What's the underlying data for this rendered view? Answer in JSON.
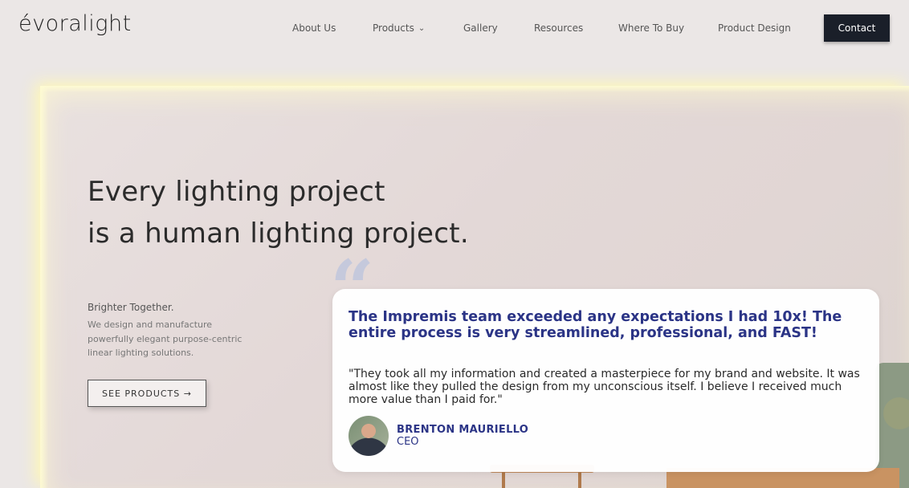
{
  "brand": {
    "logo_text": "évoralight"
  },
  "nav": {
    "items": [
      {
        "label": "About Us",
        "has_dropdown": false
      },
      {
        "label": "Products",
        "has_dropdown": true
      },
      {
        "label": "Gallery",
        "has_dropdown": false
      },
      {
        "label": "Resources",
        "has_dropdown": false
      },
      {
        "label": "Where To Buy",
        "has_dropdown": false
      },
      {
        "label": "Product Design",
        "has_dropdown": false
      }
    ],
    "contact_label": "Contact"
  },
  "hero": {
    "headline_line1": "Every lighting project",
    "headline_line2": "is a human lighting project.",
    "tagline_title": "Brighter Together.",
    "tagline_body": "We design and manufacture powerfully elegant purpose-centric linear lighting solutions.",
    "cta_label": "SEE PRODUCTS →"
  },
  "testimonial": {
    "quote_glyph": "“",
    "headline": "The Impremis team exceeded any expectations I had 10x! The entire process is very streamlined, professional, and FAST!",
    "quote": "\"They took all my information and created a masterpiece for my brand and website. It was almost like they pulled the design from my unconscious itself. I believe I received much more value than I paid for.\"",
    "name": "BRENTON MAURIELLO",
    "role": "CEO"
  },
  "colors": {
    "accent_navy": "#2b3486",
    "button_dark": "#1a1f29",
    "background": "#ebe7e6"
  },
  "icons": {
    "dropdown": "chevron-down-icon",
    "quote": "quote-icon"
  }
}
